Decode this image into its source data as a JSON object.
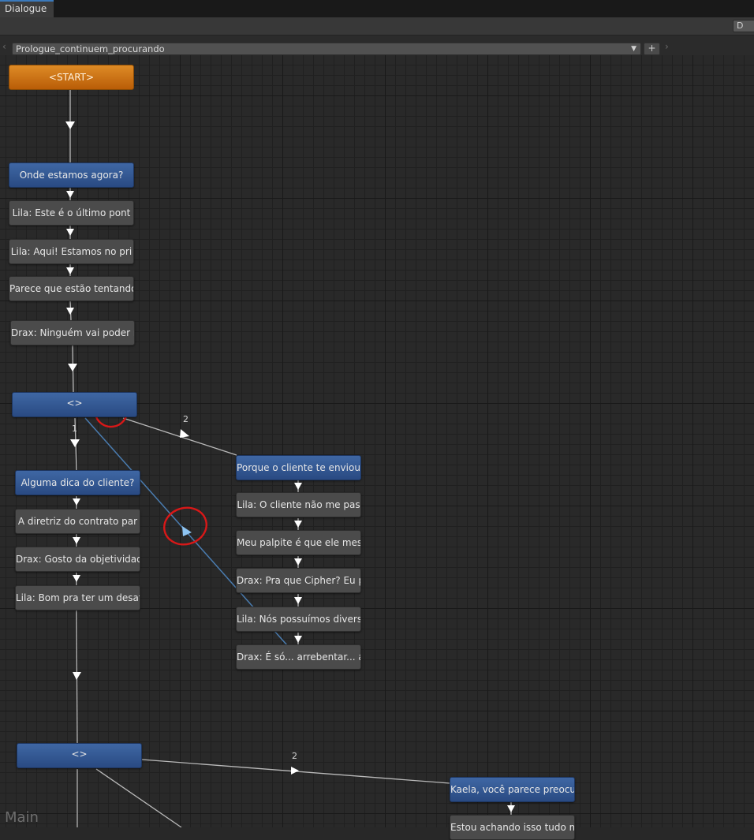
{
  "window": {
    "tab_label": "Dialogue",
    "toolbar_button_label": "D"
  },
  "conversation": {
    "selected": "Prologue_continuem_procurando",
    "add_label": "+"
  },
  "nav": {
    "prev_icon": "chevron-left-icon",
    "next_icon": "chevron-right-icon"
  },
  "canvas": {
    "watermark": "Main"
  },
  "nodes": {
    "start": "<START>",
    "a1": "Onde estamos agora?",
    "a2": "Lila: Este é o último pont",
    "a3": "Lila: Aqui! Estamos no pri",
    "a4": "Parece que estão tentando",
    "a5": "Drax: Ninguém vai poder no",
    "hub1": "<>",
    "b1": "Alguma dica do cliente?",
    "b2": "A diretriz do contrato par",
    "b3": "Drax: Gosto da objetividad",
    "b4": "Lila: Bom pra ter um desaf",
    "c1": "Porque o cliente te enviou",
    "c2": "Lila: O cliente não me pas",
    "c3": "Meu palpite é que ele mesm",
    "c4": "Drax: Pra que Cipher? Eu p",
    "c5": "Lila: Nós possuímos divers",
    "c6": "Drax: É só... arrebentar... a",
    "hub2": "<>",
    "d1": "Kaela, você parece preocup",
    "d2": "Estou achando isso tudo mu"
  },
  "link_labels": {
    "hub1_choice_1": "1",
    "hub1_choice_2": "2",
    "hub2_choice_2": "2"
  },
  "colors": {
    "start_node": "#c86f12",
    "player_node": "#3a5f9c",
    "npc_node": "#4b4b4b",
    "link": "#c8c8c8",
    "selected_link": "#4d7fb3",
    "annotation": "#d81818"
  }
}
